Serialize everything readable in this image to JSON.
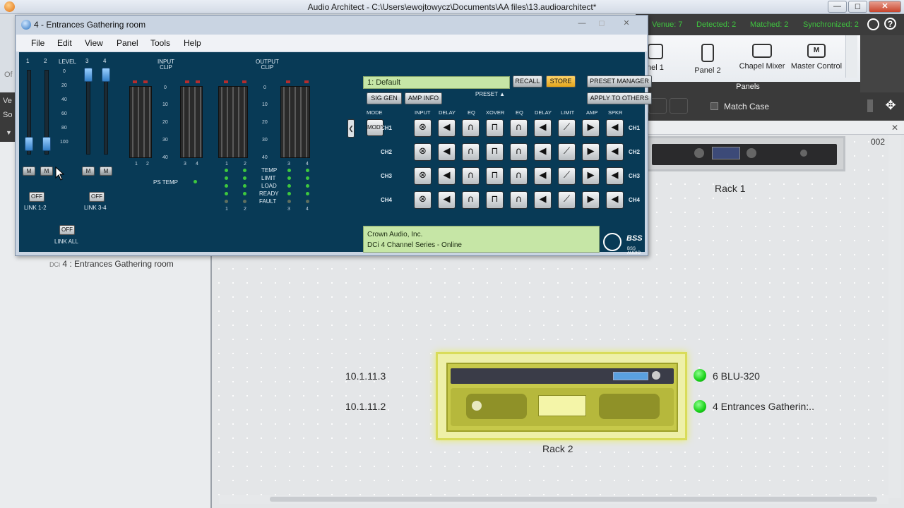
{
  "main_window": {
    "title": "Audio Architect - C:\\Users\\ewojtowycz\\Documents\\AA files\\13.audioarchitect*",
    "buttons": {
      "minimize": "—",
      "maximize": "◻",
      "close": "✕"
    }
  },
  "status": {
    "venue": "Venue: 7",
    "detected": "Detected: 2",
    "matched": "Matched: 2",
    "synchronized": "Synchronized: 2"
  },
  "ribbon": {
    "buttons": [
      "nel 1",
      "Panel 2",
      "Chapel Mixer",
      "Master Control"
    ],
    "group_label": "Panels"
  },
  "toolbar": {
    "match_case_label": "Match Case"
  },
  "left_panel": {
    "cut_labels": [
      "Ve",
      "So",
      "Of"
    ],
    "device_prefix": "DCi",
    "device_label": "4 : Entrances Gathering room"
  },
  "canvas": {
    "corner_label": "002",
    "rack1_label": "Rack 1",
    "rack2_label": "Rack 2",
    "ip_1": "10.1.11.3",
    "ip_2": "10.1.11.2",
    "device_1": "6  BLU-320",
    "device_2": "4  Entrances  Gatherin:.."
  },
  "dialog": {
    "title": "4 - Entrances  Gathering room",
    "menu": [
      "File",
      "Edit",
      "View",
      "Panel",
      "Tools",
      "Help"
    ],
    "level": {
      "channels": [
        "1",
        "2",
        "3",
        "4"
      ],
      "heading": "LEVEL",
      "scale": [
        "0",
        "20",
        "40",
        "60",
        "80",
        "100"
      ],
      "mute": "M",
      "off": "OFF",
      "link_12": "LINK 1-2",
      "link_34": "LINK 3-4",
      "link_all": "LINK ALL"
    },
    "meters": {
      "input_clip": "INPUT\nCLIP",
      "output_clip": "OUTPUT\nCLIP",
      "scale": [
        "0",
        "10",
        "20",
        "30",
        "40"
      ],
      "ps_temp": "PS TEMP",
      "status": [
        "TEMP",
        "LIMIT",
        "LOAD",
        "READY",
        "FAULT"
      ],
      "ch_pairs": [
        "1",
        "2",
        "3",
        "4"
      ]
    },
    "preset": {
      "value": "1: Default",
      "recall": "RECALL",
      "store": "STORE",
      "manager": "PRESET MANAGER",
      "apply": "APPLY TO OTHERS",
      "sig_gen": "SIG GEN",
      "amp_info": "AMP INFO",
      "preset_label": "PRESET ▲"
    },
    "chain": {
      "mode": "MODE",
      "columns": [
        "INPUT",
        "DELAY",
        "EQ",
        "XOVER",
        "EQ",
        "DELAY",
        "LIMIT",
        "AMP",
        "SPKR"
      ],
      "channels": [
        "CH1",
        "CH2",
        "CH3",
        "CH4"
      ]
    },
    "info": {
      "line1": "Crown Audio, Inc.",
      "line2": "DCi 4 Channel Series - Online"
    },
    "brand": {
      "bss": "BSS",
      "bss_sub": "BSS AUDIO"
    }
  }
}
